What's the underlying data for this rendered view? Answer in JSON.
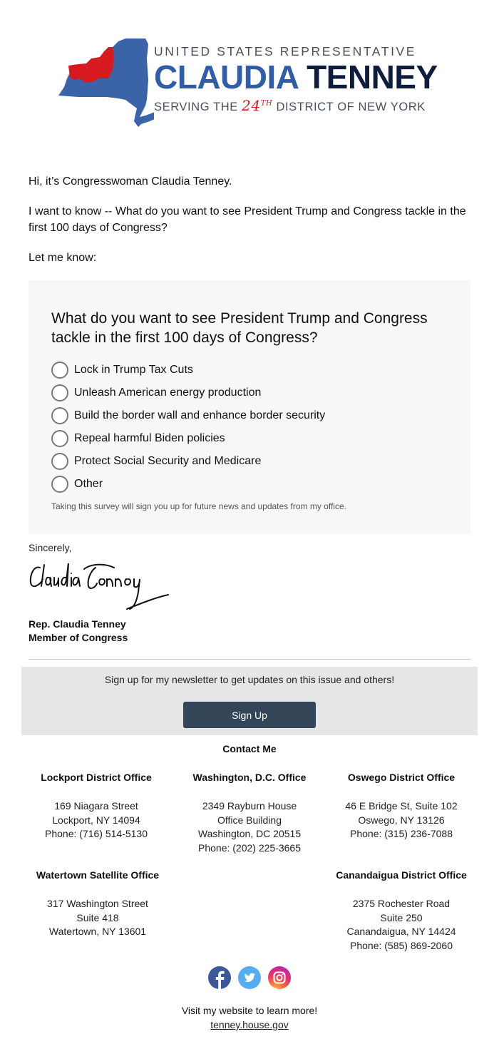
{
  "header": {
    "logo_line1": "UNITED STATES REPRESENTATIVE",
    "logo_first_name": "CLAUDIA",
    "logo_last_name": "TENNEY",
    "logo_serving": "SERVING THE",
    "logo_district_num": "24",
    "logo_district_suffix": "TH",
    "logo_district_rest": "DISTRICT OF NEW YORK",
    "colors": {
      "state_blue": "#3a63a8",
      "district_red": "#d71920",
      "name_blue": "#2f5da8",
      "name_navy": "#0f1d3d"
    }
  },
  "intro": {
    "greeting": "Hi, it’s Congresswoman Claudia Tenney.",
    "question_text": "I want to know -- What do you want to see President Trump and Congress tackle in the first 100 days of Congress?",
    "prompt": "Let me know:"
  },
  "survey": {
    "question": "What do you want to see President Trump and Congress tackle in the first 100 days of Congress?",
    "options": [
      {
        "label": "Lock in Trump Tax Cuts",
        "selected": false
      },
      {
        "label": "Unleash American energy production",
        "selected": false
      },
      {
        "label": "Build the border wall and enhance border security",
        "selected": false
      },
      {
        "label": "Repeal harmful Biden policies",
        "selected": false
      },
      {
        "label": "Protect Social Security and Medicare",
        "selected": false
      },
      {
        "label": "Other",
        "selected": false
      }
    ],
    "note": "Taking this survey will sign you up for future news and updates from my office."
  },
  "closing": {
    "sincerely": "Sincerely,",
    "signature_alt": "Claudia Tenney signature",
    "name": "Rep. Claudia Tenney",
    "title": "Member of Congress"
  },
  "newsletter": {
    "text": "Sign up for my newsletter to get updates on this issue and others!",
    "button_label": "Sign Up",
    "button_color": "#344557"
  },
  "contact": {
    "title": "Contact Me",
    "offices": [
      {
        "name": "Lockport District Office",
        "lines": [
          "169 Niagara Street",
          "Lockport, NY 14094",
          "Phone: (716) 514-5130"
        ]
      },
      {
        "name": "Washington, D.C. Office",
        "lines": [
          "2349 Rayburn House",
          "Office Building",
          "Washington, DC  20515",
          "Phone: (202) 225-3665"
        ]
      },
      {
        "name": "Oswego District Office",
        "lines": [
          "46 E Bridge St, Suite 102",
          "Oswego, NY 13126",
          "Phone: (315) 236-7088"
        ]
      },
      {
        "name": "Watertown Satellite Office",
        "lines": [
          "317 Washington Street",
          "Suite 418",
          "Watertown, NY 13601"
        ]
      },
      {
        "name": "Canandaigua District Office",
        "lines": [
          "2375 Rochester Road",
          "Suite 250",
          "Canandaigua, NY 14424",
          "Phone: (585) 869-2060"
        ]
      }
    ]
  },
  "social": {
    "icons": [
      "facebook-icon",
      "twitter-icon",
      "instagram-icon"
    ]
  },
  "footer": {
    "visit_text": "Visit my website to learn more!",
    "website_link": "tenney.house.gov"
  }
}
